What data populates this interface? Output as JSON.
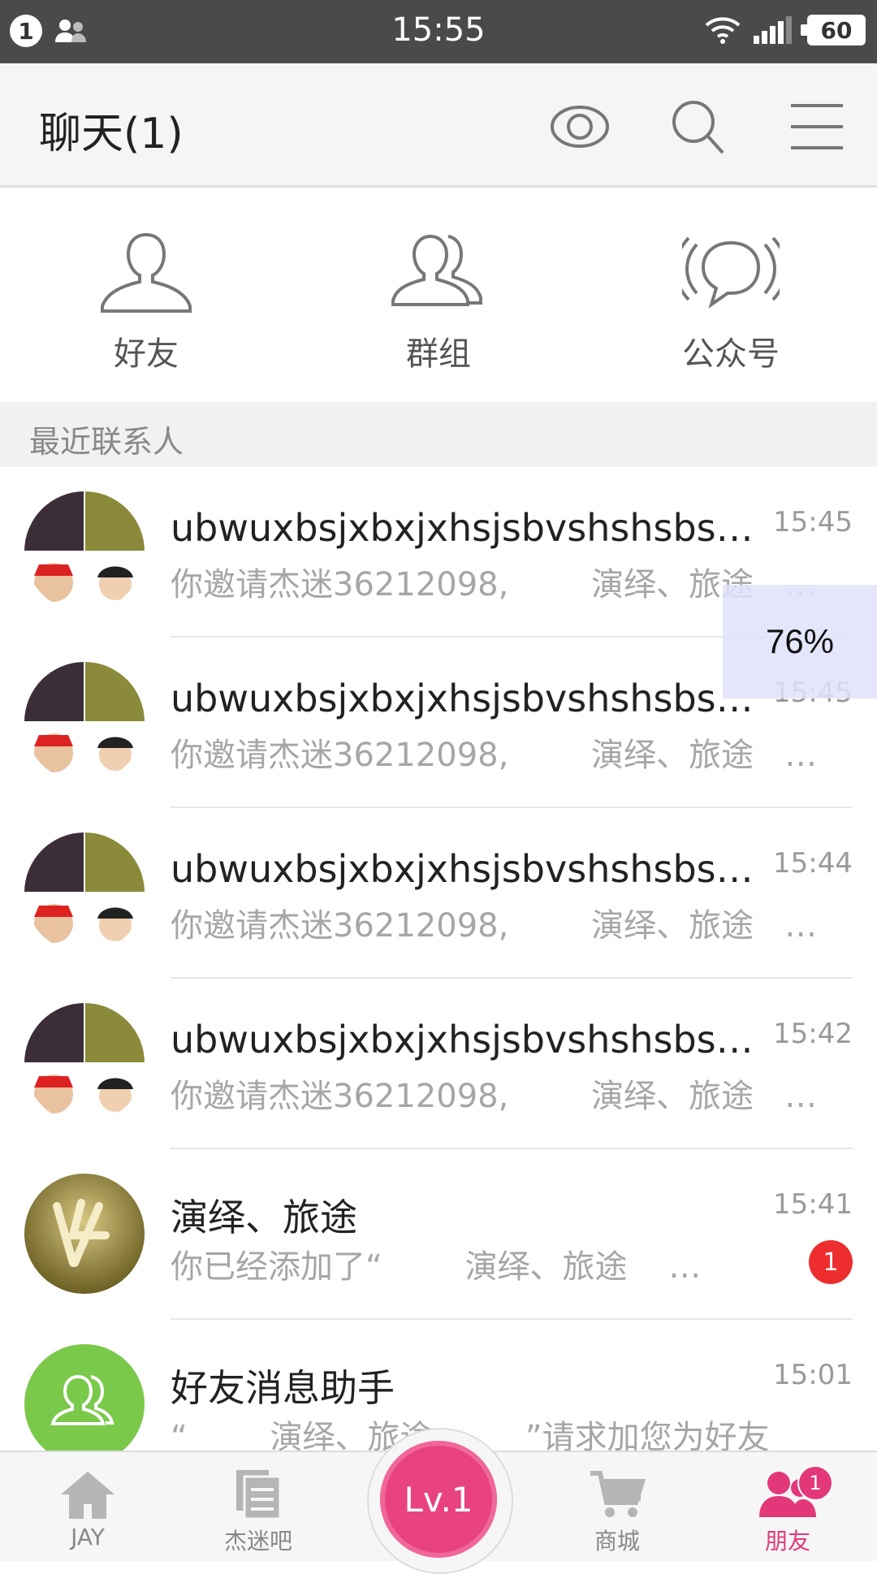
{
  "status_bar": {
    "notification_count": "1",
    "time": "15:55",
    "battery": "60"
  },
  "app_bar": {
    "title": "聊天(1)",
    "icons": [
      "eye-icon",
      "search-icon",
      "menu-icon"
    ]
  },
  "shortcuts": [
    {
      "label": "好友",
      "icon": "person-icon"
    },
    {
      "label": "群组",
      "icon": "group-icon"
    },
    {
      "label": "公众号",
      "icon": "broadcast-icon"
    }
  ],
  "section_title": "最近联系人",
  "overlay_percent": "76%",
  "chats": [
    {
      "name": "ubwuxbsjxbxjxhsjsbvshshsbsbbsbsbsb",
      "time": "15:45",
      "preview": "你邀请杰迷36212098,        演绎、旅途   …"
    },
    {
      "name": "ubwuxbsjxbxjxhsjsbvshshsbsbbsbsbsb",
      "time": "15:45",
      "preview": "你邀请杰迷36212098,        演绎、旅途   …"
    },
    {
      "name": "ubwuxbsjxbxjxhsjsbvshshsbsbbsbsbsb",
      "time": "15:44",
      "preview": "你邀请杰迷36212098,        演绎、旅途   …"
    },
    {
      "name": "ubwuxbsjxbxjxhsjsbvshshsbsbbsbsbsb",
      "time": "15:42",
      "preview": "你邀请杰迷36212098,        演绎、旅途   …"
    },
    {
      "name": "         演绎、旅途",
      "time": "15:41",
      "preview": "你已经添加了“        演绎、旅途    …",
      "unread": "1"
    },
    {
      "name": "好友消息助手",
      "time": "15:01",
      "preview": "“        演绎、旅途         ”请求加您为好友"
    }
  ],
  "tabs": [
    {
      "label": "JAY",
      "icon": "home-icon"
    },
    {
      "label": "杰迷吧",
      "icon": "document-icon"
    },
    {
      "label": "Lv.1",
      "icon": "level-icon"
    },
    {
      "label": "商城",
      "icon": "cart-icon"
    },
    {
      "label": "朋友",
      "icon": "friends-icon",
      "badge": "1",
      "active": true
    }
  ],
  "colors": {
    "accent": "#e2387a",
    "badge_red": "#ee2e2e",
    "assistant_green": "#7ac94a"
  }
}
